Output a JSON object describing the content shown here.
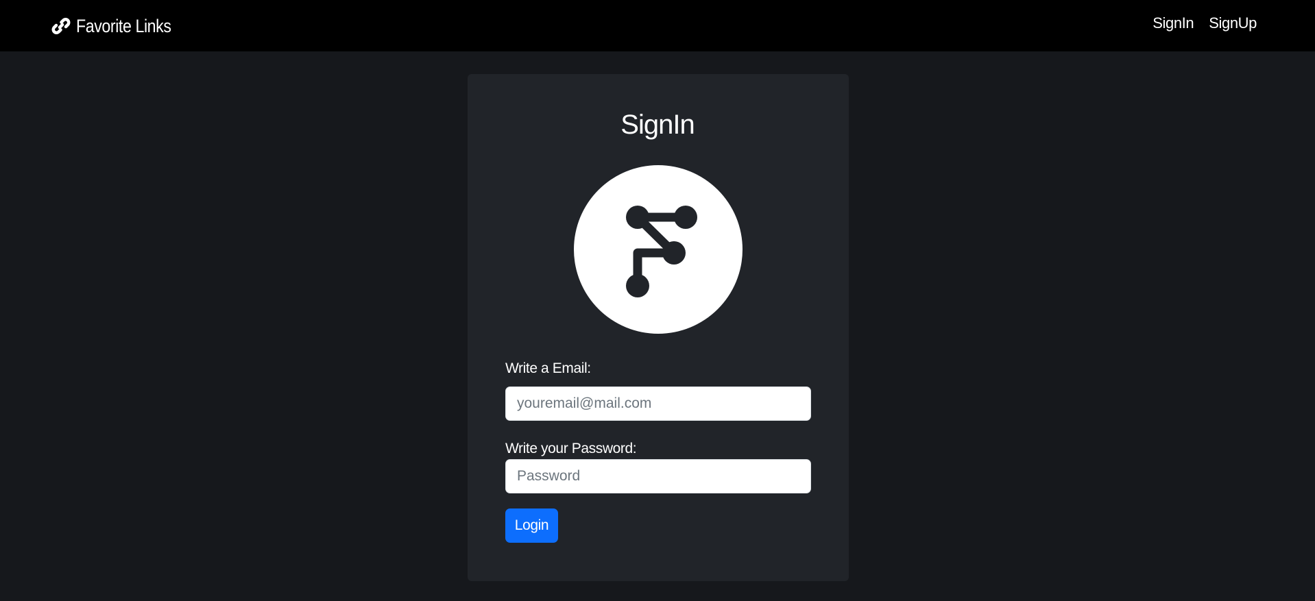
{
  "navbar": {
    "brand": {
      "icon": "link-icon",
      "label": "Favorite Links"
    },
    "links": [
      {
        "label": "SignIn"
      },
      {
        "label": "SignUp"
      }
    ]
  },
  "signin_card": {
    "title": "SignIn",
    "logo_icon": "git-branch-circle-logo",
    "email": {
      "label": "Write a Email:",
      "placeholder": "youremail@mail.com",
      "value": ""
    },
    "password": {
      "label": "Write your Password:",
      "placeholder": "Password",
      "value": ""
    },
    "submit_label": "Login"
  },
  "colors": {
    "page_background": "#16181c",
    "navbar_background": "#000000",
    "card_background": "#212429",
    "primary": "#0d6efd",
    "text": "#ffffff"
  }
}
